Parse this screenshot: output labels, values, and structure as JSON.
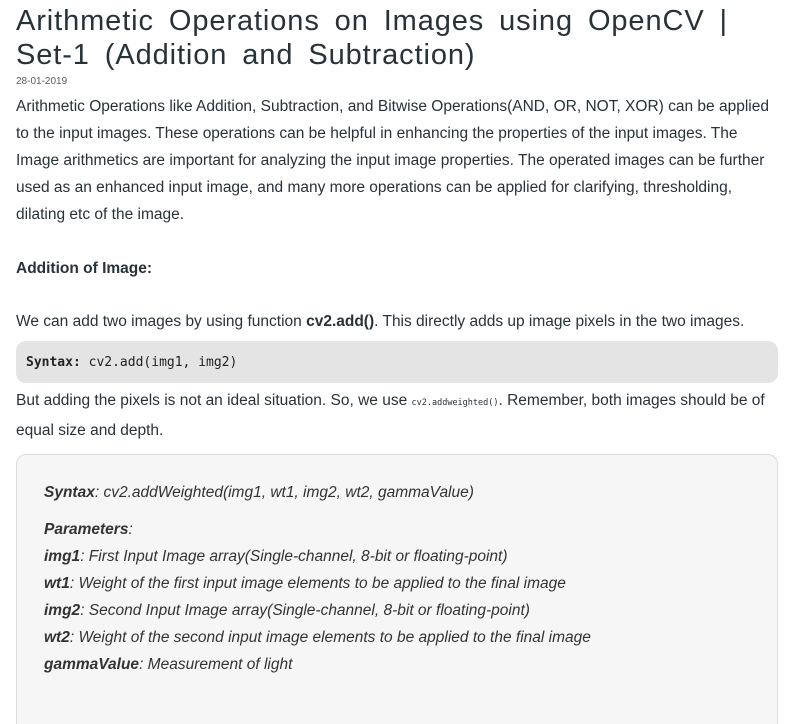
{
  "article": {
    "title": "Arithmetic Operations on Images using OpenCV | Set-1 (Addition and Subtraction)",
    "date": "28-01-2019",
    "intro": "Arithmetic Operations like Addition, Subtraction, and Bitwise Operations(AND, OR, NOT, XOR) can be applied to the input images. These operations can be helpful in enhancing the properties of the input images. The Image arithmetics are important for analyzing the input image properties. The operated images can be further used as an enhanced input image, and many more operations can be applied for clarifying, thresholding, dilating etc of the image.",
    "addition_heading": "Addition of Image:",
    "addition_text_before": "We can add two images by using function ",
    "addition_function": "cv2.add()",
    "addition_text_after": ". This directly adds up image pixels in the two images.",
    "add_syntax_label": "Syntax:",
    "add_syntax_code": " cv2.add(img1, img2)",
    "weighted_text_before": "But adding the pixels is not an ideal situation. So, we use ",
    "weighted_inline_code": "cv2.addweighted()",
    "weighted_text_after": ". Remember, both images should be of equal size and depth."
  },
  "weighted_box": {
    "syntax_label": "Syntax",
    "syntax_text": ": cv2.addWeighted(img1, wt1, img2, wt2, gammaValue)",
    "parameters_label": "Parameters",
    "parameters_colon": ":",
    "params": [
      {
        "name": "img1",
        "desc": ": First Input Image array(Single-channel, 8-bit or floating-point)"
      },
      {
        "name": "wt1",
        "desc": ": Weight of the first input image elements to be applied to the final image"
      },
      {
        "name": "img2",
        "desc": ": Second Input Image array(Single-channel, 8-bit or floating-point)"
      },
      {
        "name": "wt2",
        "desc": ": Weight of the second input image elements to be applied to the final image"
      },
      {
        "name": "gammaValue",
        "desc": ": Measurement of light"
      }
    ]
  }
}
